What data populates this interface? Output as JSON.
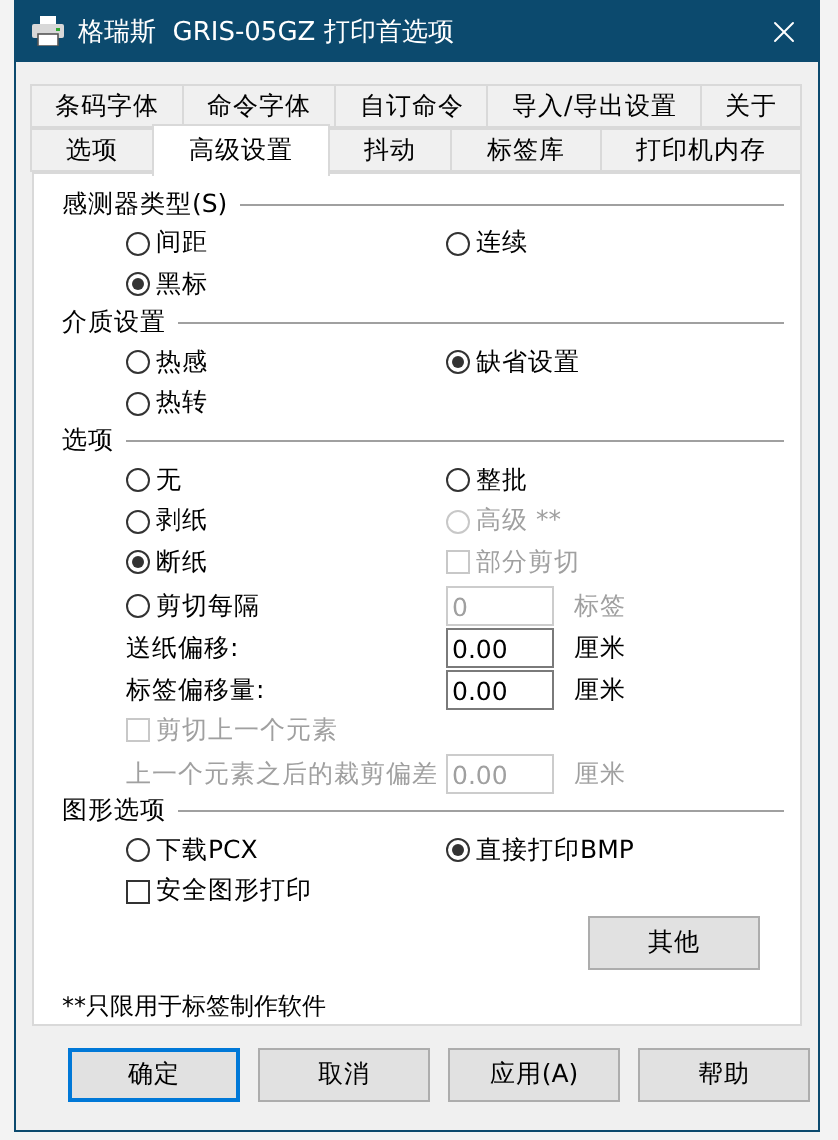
{
  "window": {
    "title": "格瑞斯  GRIS-05GZ 打印首选项"
  },
  "tab_rows": [
    [
      {
        "label": "条码字体",
        "selected": false
      },
      {
        "label": "命令字体",
        "selected": false
      },
      {
        "label": "自订命令",
        "selected": false
      },
      {
        "label": "导入/导出设置",
        "selected": false
      },
      {
        "label": "关于",
        "selected": false
      }
    ],
    [
      {
        "label": "选项",
        "selected": false
      },
      {
        "label": "高级设置",
        "selected": true
      },
      {
        "label": "抖动",
        "selected": false
      },
      {
        "label": "标签库",
        "selected": false
      },
      {
        "label": "打印机内存",
        "selected": false
      }
    ]
  ],
  "sections": [
    {
      "title": "感测器类型(S)",
      "rows": [
        [
          {
            "kind": "radio",
            "label": "间距",
            "selected": false,
            "disabled": false
          },
          {
            "kind": "radio",
            "label": "连续",
            "selected": false,
            "disabled": false
          }
        ],
        [
          {
            "kind": "radio",
            "label": "黑标",
            "selected": true,
            "disabled": false
          }
        ]
      ]
    },
    {
      "title": "介质设置",
      "rows": [
        [
          {
            "kind": "radio",
            "label": "热感",
            "selected": false,
            "disabled": false
          },
          {
            "kind": "radio",
            "label": "缺省设置",
            "selected": true,
            "disabled": false
          }
        ],
        [
          {
            "kind": "radio",
            "label": "热转",
            "selected": false,
            "disabled": false
          }
        ]
      ]
    },
    {
      "title": "选项",
      "rows": [
        [
          {
            "kind": "radio",
            "label": "无",
            "selected": false,
            "disabled": false
          },
          {
            "kind": "radio",
            "label": "整批",
            "selected": false,
            "disabled": false
          }
        ],
        [
          {
            "kind": "radio",
            "label": "剥纸",
            "selected": false,
            "disabled": false
          },
          {
            "kind": "radio",
            "label": "高级 **",
            "selected": false,
            "disabled": true
          }
        ],
        [
          {
            "kind": "radio",
            "label": "断纸",
            "selected": true,
            "disabled": false
          },
          {
            "kind": "checkbox",
            "label": "部分剪切",
            "checked": false,
            "disabled": true
          }
        ],
        [
          {
            "kind": "radio",
            "label": "剪切每隔",
            "selected": false,
            "disabled": false
          },
          {
            "kind": "field",
            "value": "0",
            "unit": "标签",
            "disabled": true
          }
        ],
        [
          {
            "kind": "field",
            "label": "送纸偏移:",
            "value": "0.00",
            "unit": "厘米",
            "disabled": false
          }
        ],
        [
          {
            "kind": "field",
            "label": "标签偏移量:",
            "value": "0.00",
            "unit": "厘米",
            "disabled": false
          }
        ],
        [
          {
            "kind": "checkbox",
            "label": "剪切上一个元素",
            "checked": false,
            "disabled": true
          }
        ],
        [
          {
            "kind": "field",
            "label": "上一个元素之后的裁剪偏差",
            "value": "0.00",
            "unit": "厘米",
            "disabled": true
          }
        ]
      ]
    },
    {
      "title": "图形选项",
      "rows": [
        [
          {
            "kind": "radio",
            "label": "下载PCX",
            "selected": false,
            "disabled": false
          },
          {
            "kind": "radio",
            "label": "直接打印BMP",
            "selected": true,
            "disabled": false
          }
        ],
        [
          {
            "kind": "checkbox",
            "label": "安全图形打印",
            "checked": false,
            "disabled": false
          }
        ]
      ]
    }
  ],
  "other_button": "其他",
  "footnote": "**只限用于标签制作软件",
  "buttons": [
    {
      "label": "确定",
      "default": true
    },
    {
      "label": "取消",
      "default": false
    },
    {
      "label": "应用(A)",
      "default": false
    },
    {
      "label": "帮助",
      "default": false
    }
  ]
}
